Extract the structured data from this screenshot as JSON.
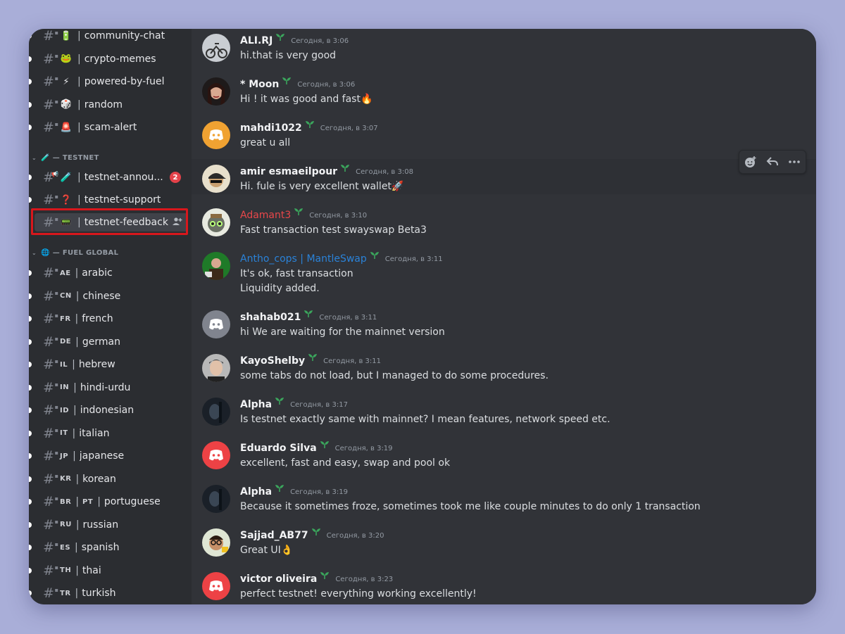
{
  "sidebar": {
    "channels_top": [
      {
        "emoji": "🔋",
        "name": "community-chat"
      },
      {
        "emoji": "🐸",
        "name": "crypto-memes"
      },
      {
        "emoji": "⚡",
        "name": "powered-by-fuel"
      },
      {
        "emoji": "🎲",
        "name": "random"
      },
      {
        "emoji": "🚨",
        "name": "scam-alert"
      }
    ],
    "category_testnet": {
      "icon": "🧪",
      "label": "— TESTNET"
    },
    "channels_testnet": [
      {
        "emoji": "🧪",
        "name": "testnet-annou...",
        "badge": "2",
        "type": "announcement"
      },
      {
        "emoji": "❓",
        "name": "testnet-support"
      },
      {
        "emoji": "📟",
        "name": "testnet-feedback",
        "selected": true
      }
    ],
    "category_global": {
      "icon": "🌐",
      "label": "— FUEL GLOBAL"
    },
    "channels_global": [
      {
        "flags": [
          "AE"
        ],
        "name": "arabic"
      },
      {
        "flags": [
          "CN"
        ],
        "name": "chinese"
      },
      {
        "flags": [
          "FR"
        ],
        "name": "french"
      },
      {
        "flags": [
          "DE"
        ],
        "name": "german"
      },
      {
        "flags": [
          "IL"
        ],
        "name": "hebrew"
      },
      {
        "flags": [
          "IN"
        ],
        "name": "hindi-urdu"
      },
      {
        "flags": [
          "ID"
        ],
        "name": "indonesian"
      },
      {
        "flags": [
          "IT"
        ],
        "name": "italian"
      },
      {
        "flags": [
          "JP"
        ],
        "name": "japanese"
      },
      {
        "flags": [
          "KR"
        ],
        "name": "korean"
      },
      {
        "flags": [
          "BR",
          "PT"
        ],
        "name": "portuguese"
      },
      {
        "flags": [
          "RU"
        ],
        "name": "russian"
      },
      {
        "flags": [
          "ES"
        ],
        "name": "spanish"
      },
      {
        "flags": [
          "TH"
        ],
        "name": "thai"
      },
      {
        "flags": [
          "TR"
        ],
        "name": "turkish"
      }
    ]
  },
  "messages": [
    {
      "user": "ALI.RJ",
      "time": "Сегодня, в 3:06",
      "lines": [
        "hi.that is very good"
      ],
      "avatar": "photo-bike",
      "color": "default"
    },
    {
      "user": "* Moon",
      "time": "Сегодня, в 3:06",
      "lines": [
        "Hi ! it was good and fast🔥"
      ],
      "avatar": "photo-girl",
      "color": "default"
    },
    {
      "user": "mahdi1022",
      "time": "Сегодня, в 3:07",
      "lines": [
        "great u all"
      ],
      "avatar": "discord-orange",
      "color": "default"
    },
    {
      "user": "amir esmaeilpour",
      "time": "Сегодня, в 3:08",
      "lines": [
        "Hi. fule is very excellent wallet🚀"
      ],
      "avatar": "photo-cap",
      "color": "default"
    },
    {
      "user": "Adamant3",
      "time": "Сегодня, в 3:10",
      "lines": [
        "Fast transaction test swayswap Beta3"
      ],
      "avatar": "photo-robot",
      "color": "red"
    },
    {
      "user": "Antho_cops | MantleSwap",
      "time": "Сегодня, в 3:11",
      "lines": [
        "It's ok, fast transaction",
        "Liquidity added."
      ],
      "avatar": "photo-green",
      "color": "blue"
    },
    {
      "user": "shahab021",
      "time": "Сегодня, в 3:11",
      "lines": [
        "hi We are waiting for the mainnet version"
      ],
      "avatar": "discord-grey",
      "color": "default"
    },
    {
      "user": "KayoShelby",
      "time": "Сегодня, в 3:11",
      "lines": [
        "some tabs do not load, but I managed to do some procedures."
      ],
      "avatar": "photo-man",
      "color": "default"
    },
    {
      "user": "Alpha",
      "time": "Сегодня, в 3:17",
      "lines": [
        "Is testnet exactly same with mainnet? I mean features, network speed etc."
      ],
      "avatar": "photo-dark",
      "color": "default"
    },
    {
      "user": "Eduardo Silva",
      "time": "Сегодня, в 3:19",
      "lines": [
        "excellent, fast and easy, swap and pool ok"
      ],
      "avatar": "discord-red",
      "color": "default"
    },
    {
      "user": "Alpha",
      "time": "Сегодня, в 3:19",
      "lines": [
        "Because it sometimes froze, sometimes took me like couple minutes to do only 1 transaction"
      ],
      "avatar": "photo-dark",
      "color": "default"
    },
    {
      "user": "Sajjad_AB77",
      "time": "Сегодня, в 3:20",
      "lines": [
        "Great UI👌"
      ],
      "avatar": "photo-glasses",
      "color": "default"
    },
    {
      "user": "victor oliveira",
      "time": "Сегодня, в 3:23",
      "lines": [
        "perfect testnet! everything working excellently!"
      ],
      "avatar": "discord-red",
      "color": "default"
    }
  ],
  "toolbar": {
    "icons": [
      "add-reaction-icon",
      "reply-icon",
      "more-icon"
    ]
  },
  "colors": {
    "accent_red": "#e8474a",
    "accent_blue": "#2a82d8",
    "badge": "#e3424a",
    "highlight": "#d8171c",
    "discord_orange": "#f0a232",
    "discord_grey": "#80848e",
    "discord_red": "#ed4245"
  }
}
